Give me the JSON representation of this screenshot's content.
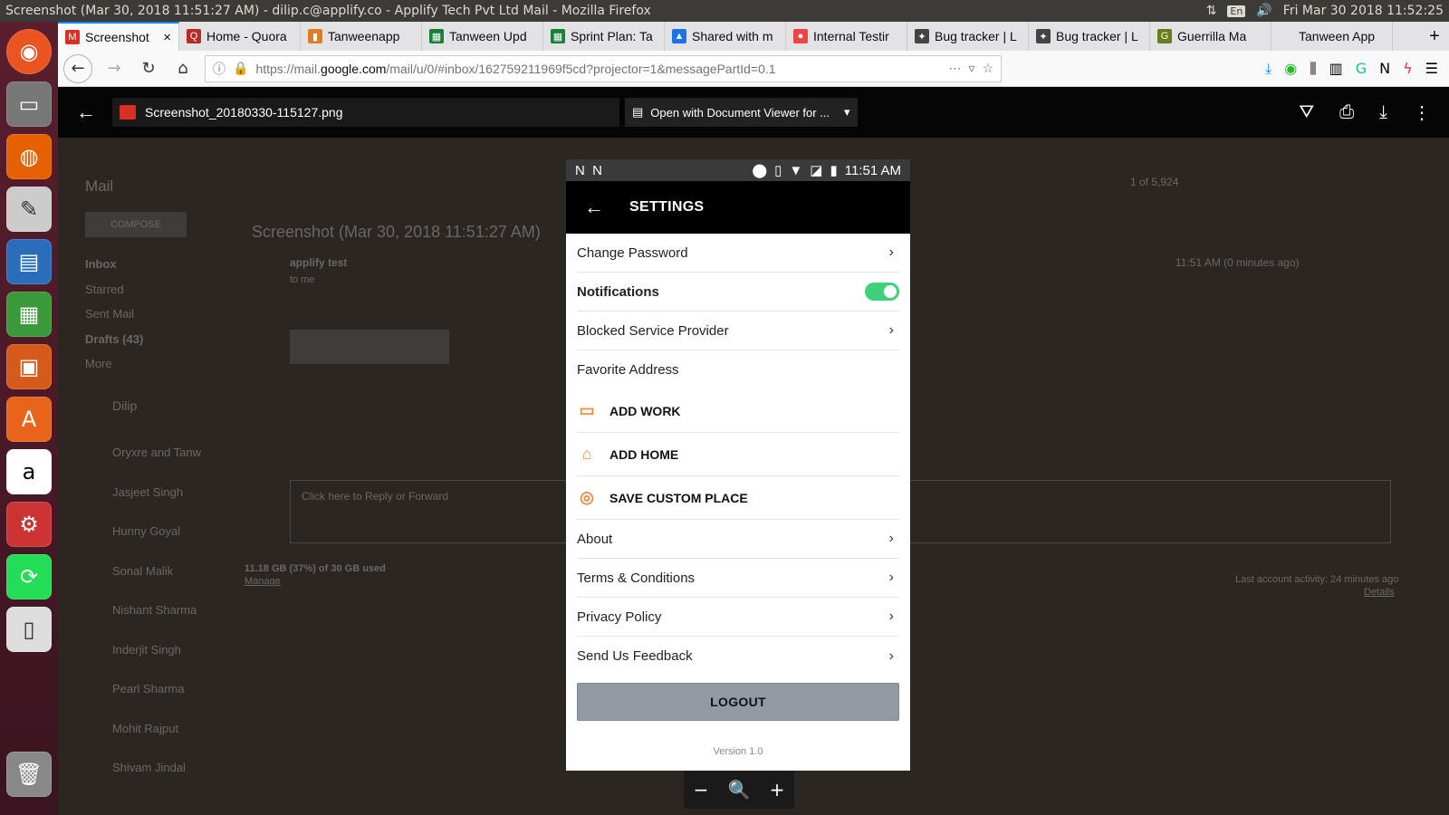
{
  "os": {
    "window_title": "Screenshot (Mar 30, 2018 11:51:27 AM) - dilip.c@applify.co - Applify Tech Pvt Ltd Mail - Mozilla Firefox",
    "lang": "En",
    "clock": "Fri Mar 30 2018 11:52:25"
  },
  "tabs": [
    {
      "label": "Screenshot",
      "active": true,
      "fav": "M",
      "color": "#d93025"
    },
    {
      "label": "Home - Quora",
      "fav": "Q",
      "color": "#b92b27"
    },
    {
      "label": "Tanweenapp",
      "fav": "▮",
      "color": "#e07b24"
    },
    {
      "label": "Tanween Upd",
      "fav": "▦",
      "color": "#188038"
    },
    {
      "label": "Sprint Plan: Ta",
      "fav": "▦",
      "color": "#188038"
    },
    {
      "label": "Shared with m",
      "fav": "▲",
      "color": "#1a73e8"
    },
    {
      "label": "Internal Testir",
      "fav": "●",
      "color": "#e44"
    },
    {
      "label": "Bug tracker | L",
      "fav": "✦",
      "color": "#444"
    },
    {
      "label": "Bug tracker | L",
      "fav": "✦",
      "color": "#444"
    },
    {
      "label": "Guerrilla Ma",
      "fav": "G",
      "color": "#6a7d18"
    },
    {
      "label": "Tanween App",
      "fav": "",
      "color": "transparent"
    }
  ],
  "url": {
    "prefix": "https://mail.",
    "domain": "google.com",
    "path": "/mail/u/0/#inbox/162759211969f5cd?projector=1&messagePartId=0.1"
  },
  "viewer": {
    "filename": "Screenshot_20180330-115127.png",
    "open_with": "Open with Document Viewer for ..."
  },
  "gmail_bg": {
    "mail_label": "Mail",
    "compose": "COMPOSE",
    "nav": [
      "Inbox",
      "Starred",
      "Sent Mail",
      "Drafts (43)",
      "More"
    ],
    "subject": "Screenshot (Mar 30, 2018 11:51:27 AM)",
    "sender": "applify test",
    "to": "to me",
    "time": "11:51 AM (0 minutes ago)",
    "pager": "1 of 5,924",
    "reply_hint": "Click here to Reply or Forward",
    "storage": "11.18 GB (37%) of 30 GB used",
    "manage": "Manage",
    "activity": "Last account activity: 24 minutes ago",
    "details": "Details",
    "user": "Dilip",
    "contacts": [
      "Oryxre and Tanw",
      "Jasjeet Singh",
      "Hunny Goyal",
      "Sonal Malik",
      "Nishant Sharma",
      "Inderjit Singh",
      "Pearl Sharma",
      "Mohit Rajput",
      "Shivam Jindal"
    ]
  },
  "phone": {
    "time": "11:51 AM",
    "title": "SETTINGS",
    "change_password": "Change Password",
    "notifications": "Notifications",
    "notifications_on": true,
    "blocked": "Blocked Service Provider",
    "favorite_address": "Favorite Address",
    "add_work": "ADD WORK",
    "add_home": "ADD HOME",
    "save_custom": "SAVE CUSTOM PLACE",
    "about": "About",
    "terms": "Terms & Conditions",
    "privacy": "Privacy Policy",
    "feedback": "Send Us Feedback",
    "logout": "LOGOUT",
    "version": "Version 1.0"
  }
}
